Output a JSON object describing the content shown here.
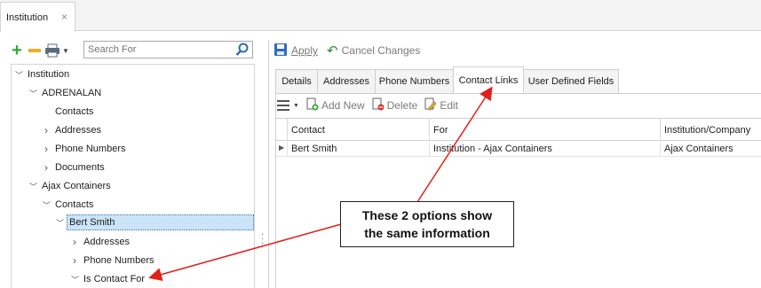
{
  "doc_tab": {
    "title": "Institution",
    "close": "×"
  },
  "left_toolbar": {
    "add_icon": "plus-icon",
    "remove_icon": "minus-icon",
    "print_icon": "printer-icon",
    "search_placeholder": "Search For",
    "search_icon": "magnifier-icon"
  },
  "tree": [
    {
      "label": "Institution",
      "chevron": "﹀"
    },
    {
      "label": "ADRENALAN",
      "chevron": "﹀"
    },
    {
      "label": "Contacts",
      "chevron": ""
    },
    {
      "label": "Addresses",
      "chevron": "›"
    },
    {
      "label": "Phone Numbers",
      "chevron": "›"
    },
    {
      "label": "Documents",
      "chevron": "›"
    },
    {
      "label": "Ajax Containers",
      "chevron": "﹀"
    },
    {
      "label": "Contacts",
      "chevron": "﹀"
    },
    {
      "label": "Bert Smith",
      "chevron": "﹀"
    },
    {
      "label": "Addresses",
      "chevron": "›"
    },
    {
      "label": "Phone Numbers",
      "chevron": "›"
    },
    {
      "label": "Is Contact For",
      "chevron": "﹀"
    }
  ],
  "action_bar": {
    "apply": "Apply",
    "cancel": "Cancel Changes"
  },
  "tabs": [
    {
      "label": "Details"
    },
    {
      "label": "Addresses"
    },
    {
      "label": "Phone Numbers"
    },
    {
      "label": "Contact Links"
    },
    {
      "label": "User Defined Fields"
    }
  ],
  "grid_toolbar": {
    "add_new": "Add New",
    "delete": "Delete",
    "edit": "Edit"
  },
  "grid": {
    "columns": [
      "Contact",
      "For",
      "Institution/Company"
    ],
    "rows": [
      [
        "Bert Smith",
        "Institution - Ajax Containers",
        "Ajax Containers"
      ]
    ]
  },
  "callout": {
    "line1": "These 2 options show",
    "line2": "the same information"
  },
  "colors": {
    "accent": "#2e6db4",
    "arrow": "#e0201b",
    "selection": "#cce4f7"
  }
}
